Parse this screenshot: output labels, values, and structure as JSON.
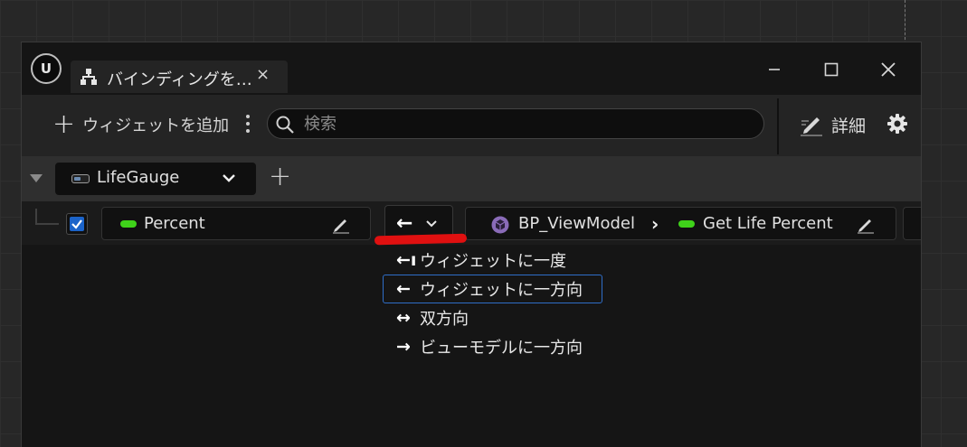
{
  "window": {
    "logo_text": "U",
    "tab_title": "バインディングを…",
    "tab_close": "×"
  },
  "toolbar": {
    "add_widget_label": "ウィジェットを追加",
    "search_placeholder": "検索",
    "details_label": "詳細"
  },
  "viewmodel_bar": {
    "selected_viewmodel": "LifeGauge"
  },
  "binding": {
    "checked": true,
    "widget_property": "Percent",
    "mode_glyph": "←",
    "viewmodel_name": "BP_ViewModel",
    "path_separator": "›",
    "viewmodel_property": "Get Life Percent"
  },
  "mode_dropdown": {
    "items": [
      {
        "glyph": "←ı",
        "label": "ウィジェットに一度",
        "selected": false
      },
      {
        "glyph": "←",
        "label": "ウィジェットに一方向",
        "selected": true
      },
      {
        "glyph": "↔",
        "label": "双方向",
        "selected": false
      },
      {
        "glyph": "→",
        "label": "ビューモデルに一方向",
        "selected": false
      }
    ]
  },
  "colors": {
    "accent_blue": "#2f6ec8",
    "binding_green": "#3fd21a",
    "annotation_red": "#e01010",
    "viewmodel_icon_purple": "#8a6bb8"
  },
  "icons": {
    "tab": "hierarchy-icon",
    "search": "search-icon",
    "details": "pencil-edit-icon",
    "settings": "gear-icon"
  }
}
